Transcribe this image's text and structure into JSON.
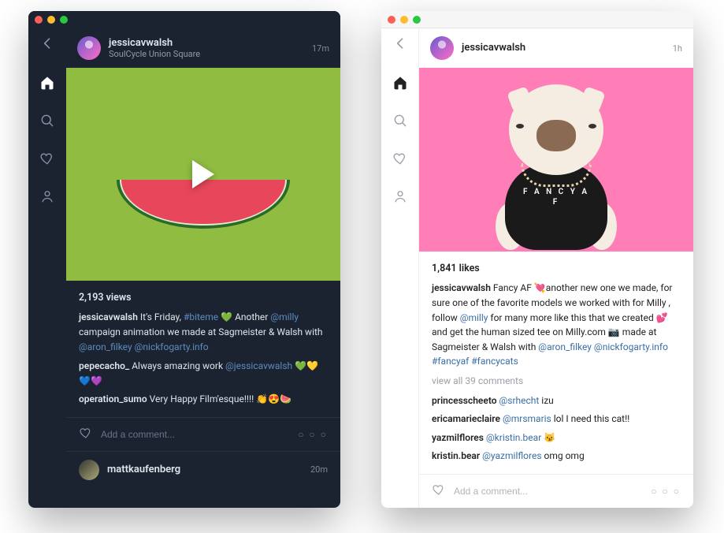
{
  "dark": {
    "header": {
      "username": "jessicavwalsh",
      "location": "SoulCycle Union Square",
      "timestamp": "17m"
    },
    "views": "2,193 views",
    "caption_user": "jessicavwalsh",
    "caption_pre": " It's Friday, ",
    "caption_hashtag": "#biteme",
    "caption_mid": " 💚 Another ",
    "caption_link1": "@milly",
    "caption_tail": " campaign animation we made at Sagmeister & Walsh with ",
    "caption_link2": "@aron_filkey",
    "caption_link3": " @nickfogarty.info",
    "comments": [
      {
        "user": "pepecacho_",
        "pre": " Always amazing work ",
        "link": "@jessicavwalsh",
        "post": " 💚💛💙💜"
      },
      {
        "user": "operation_sumo",
        "pre": " Very Happy Film'esque!!!! 👏😍🍉",
        "link": "",
        "post": ""
      }
    ],
    "add_placeholder": "Add a comment...",
    "next_user": "mattkaufenberg",
    "next_time": "20m"
  },
  "light": {
    "header": {
      "username": "jessicavwalsh",
      "timestamp": "1h"
    },
    "likes": "1,841 likes",
    "caption_user": "jessicavwalsh",
    "caption_pre": " Fancy AF 💘another new one we made, for sure one of the favorite models we worked with for Milly , follow ",
    "caption_link1": "@milly",
    "caption_mid": " for many more like this that we created 💕and get the human sized tee on Milly.com 📷 made at Sagmeister & Walsh with ",
    "caption_link2": "@aron_filkey",
    "caption_link3": " @nickfogarty.info ",
    "caption_hash1": "#fancyaf",
    "caption_hash2": " #fancycats",
    "viewall": "view all 39 comments",
    "comments": [
      {
        "user": "princesscheeto",
        "pre": " ",
        "link": "@srhecht",
        "post": " izu"
      },
      {
        "user": "ericamarieclaire",
        "pre": " ",
        "link": "@mrsmaris",
        "post": " lol I need this cat!!"
      },
      {
        "user": "yazmilflores",
        "pre": " ",
        "link": "@kristin.bear",
        "post": " 😼"
      },
      {
        "user": "kristin.bear",
        "pre": " ",
        "link": "@yazmilflores",
        "post": " omg omg"
      }
    ],
    "add_placeholder": "Add a comment...",
    "shirt_text": "F A N C Y\nA F"
  }
}
